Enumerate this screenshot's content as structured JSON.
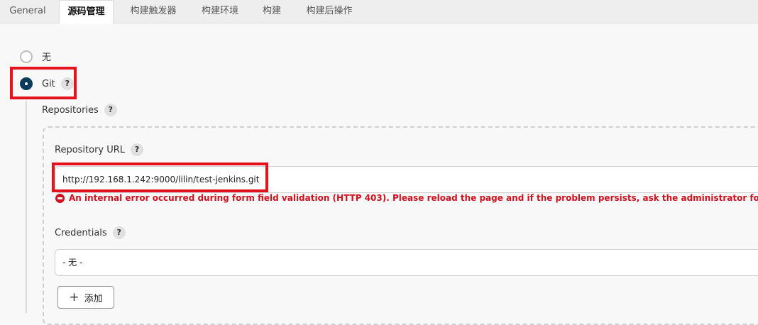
{
  "tabs": [
    "General",
    "源码管理",
    "构建触发器",
    "构建环境",
    "构建",
    "构建后操作"
  ],
  "active_tab": "源码管理",
  "scm": {
    "option_none": "无",
    "option_git": "Git",
    "selected": "Git"
  },
  "help_mark": "?",
  "repositories": {
    "label": "Repositories",
    "url_label": "Repository URL",
    "url_value": "http://192.168.1.242:9000/lilin/test-jenkins.git",
    "error_text": "An internal error occurred during form field validation (HTTP 403). Please reload the page and if the problem persists, ask the administrator for help.",
    "credentials_label": "Credentials",
    "credentials_value": "- 无 -",
    "add_button_label": "添加",
    "add_button_icon": "plus-icon"
  },
  "colors": {
    "highlight": "#e3121d",
    "error": "#d1101d",
    "radio_checked": "#0b3c5d"
  }
}
